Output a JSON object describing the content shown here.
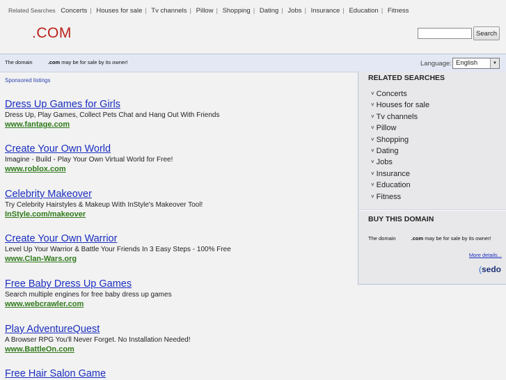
{
  "top_related": {
    "lead": "Related Searches",
    "items": [
      "Concerts",
      "Houses for sale",
      "Tv channels",
      "Pillow",
      "Shopping",
      "Dating",
      "Jobs",
      "Insurance",
      "Education",
      "Fitness"
    ]
  },
  "header": {
    "logo": ".COM",
    "search_placeholder": "",
    "search_button": "Search"
  },
  "strip": {
    "msg_pre": "The domain",
    "msg_domain": ".com",
    "msg_post": "may be for sale by its owner!",
    "language_label": "Language:",
    "language_value": "English"
  },
  "sponsored_label": "Sponsored listings",
  "listings": [
    {
      "title": "Dress Up Games for Girls",
      "desc": "Dress Up, Play Games, Collect Pets Chat and Hang Out With Friends",
      "url": "www.fantage.com"
    },
    {
      "title": "Create Your Own World",
      "desc": "Imagine - Build - Play Your Own Virtual World for Free!",
      "url": "www.roblox.com"
    },
    {
      "title": "Celebrity Makeover",
      "desc": "Try Celebrity Hairstyles & Makeup With InStyle's Makeover Tool!",
      "url": "InStyle.com/makeover"
    },
    {
      "title": "Create Your Own Warrior",
      "desc": "Level Up Your Warrior & Battle Your Friends In 3 Easy Steps - 100% Free",
      "url": "www.Clan-Wars.org"
    },
    {
      "title": "Free Baby Dress Up Games",
      "desc": "Search multiple engines for free baby dress up games",
      "url": "www.webcrawler.com"
    },
    {
      "title": "Play AdventureQuest",
      "desc": "A Browser RPG You'll Never Forget. No Installation Needed!",
      "url": "www.BattleOn.com"
    },
    {
      "title": "Free Hair Salon Game",
      "desc": "",
      "url": ""
    }
  ],
  "panel": {
    "related_title": "RELATED SEARCHES",
    "related_items": [
      "Concerts",
      "Houses for sale",
      "Tv channels",
      "Pillow",
      "Shopping",
      "Dating",
      "Jobs",
      "Insurance",
      "Education",
      "Fitness"
    ],
    "buy_title": "BUY THIS DOMAIN",
    "buy_pre": "The domain",
    "buy_domain": ".com",
    "buy_post": "may be for sale by its owner!",
    "more_details": "More details...",
    "brand": "sedo"
  }
}
